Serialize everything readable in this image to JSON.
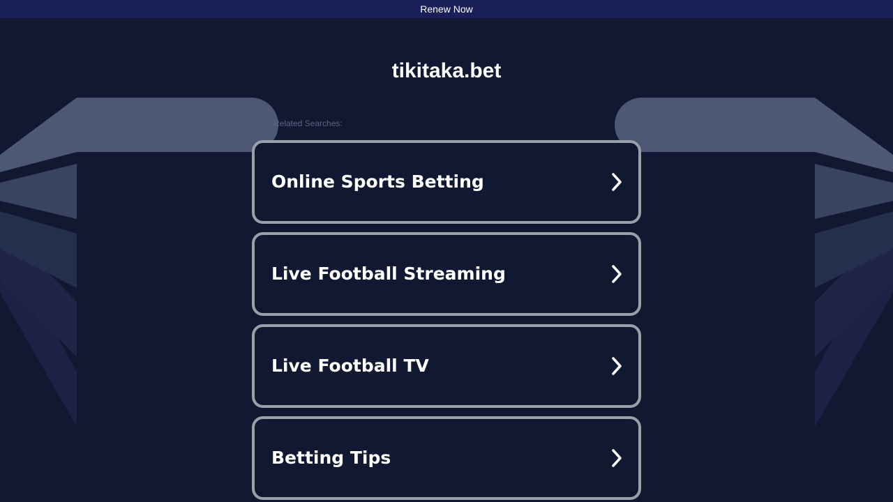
{
  "renew_bar": {
    "label": "Renew Now"
  },
  "domain": {
    "title": "tikitaka.bet"
  },
  "related": {
    "label": "Related Searches:"
  },
  "results": [
    {
      "label": "Online Sports Betting"
    },
    {
      "label": "Live Football Streaming"
    },
    {
      "label": "Live Football TV"
    },
    {
      "label": "Betting Tips"
    }
  ],
  "icons": {
    "result_arrow": "chevron-right-icon"
  },
  "colors": {
    "background": "#111831",
    "renew_bar": "#1a1f5a",
    "card_border": "#9ba0a8",
    "text": "#ffffff",
    "wing_1": "#4e5775",
    "wing_2": "#3a4362",
    "wing_3": "#262e4e",
    "wing_4": "#1e2546",
    "wing_5": "#1b2245"
  }
}
